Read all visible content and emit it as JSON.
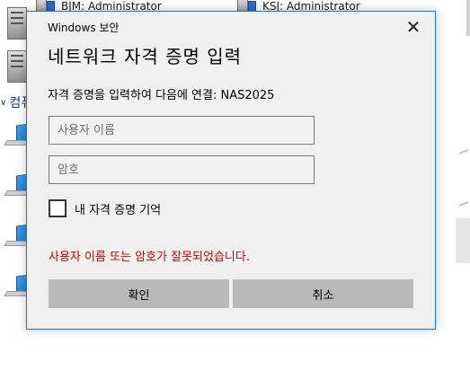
{
  "background": {
    "items": [
      {
        "label": "BJM: Administrator"
      },
      {
        "label": "KSJ: Administrator"
      }
    ],
    "section_label": "컴퓨"
  },
  "dialog": {
    "title": "Windows 보안",
    "heading": "네트워크 자격 증명 입력",
    "connect_text": "자격 증명을 입력하여 다음에 연결: NAS2025",
    "username": {
      "value": "",
      "placeholder": "사용자 이름"
    },
    "password": {
      "value": "",
      "placeholder": "암호"
    },
    "remember_label": "내 자격 증명 기억",
    "remember_checked": false,
    "error_text": "사용자 이름 또는 암호가 잘못되었습니다.",
    "ok_label": "확인",
    "cancel_label": "취소",
    "close_glyph": "✕"
  },
  "colors": {
    "accent_border": "#1979ca",
    "error": "#c50000",
    "dialog_bg": "#f0f0f0",
    "button_bg": "#b9b9b9"
  }
}
